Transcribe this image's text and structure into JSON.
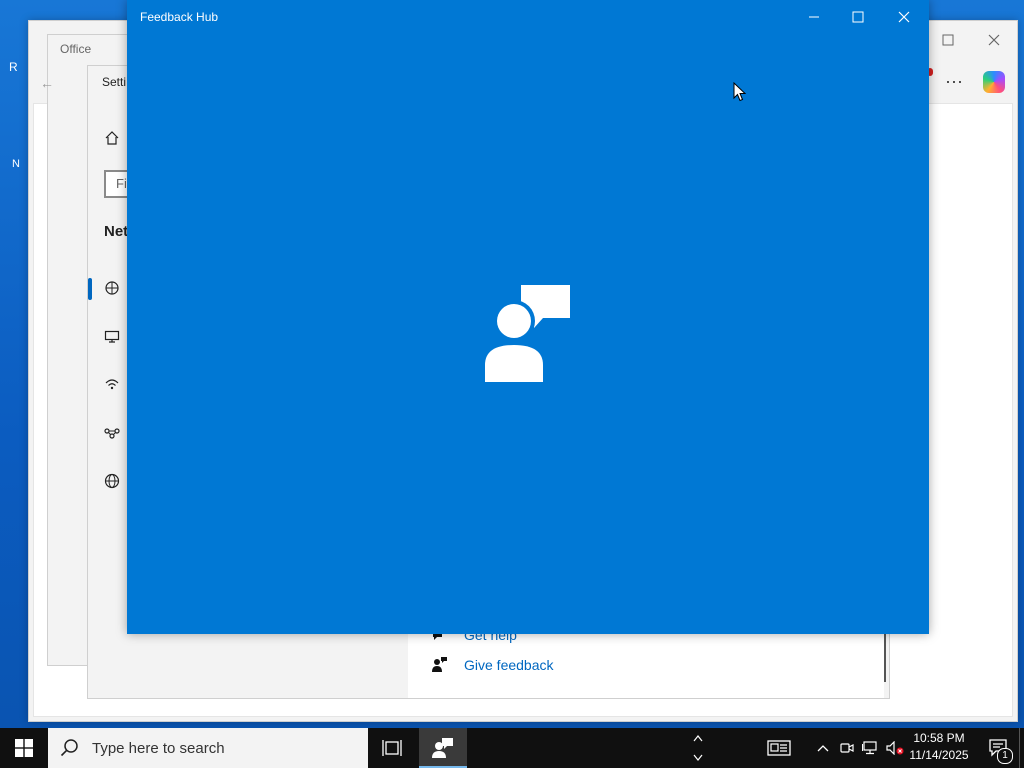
{
  "desktop": {
    "icon_labels": [
      "R",
      "N"
    ]
  },
  "edge_window": {
    "toolbar_more": "···"
  },
  "office_window": {
    "title": "Office"
  },
  "settings_window": {
    "title": "Setti",
    "find_placeholder": "Fi",
    "section_title": "Net",
    "links": {
      "get_help": "Get help",
      "give_feedback": "Give feedback"
    }
  },
  "feedback_window": {
    "title": "Feedback Hub"
  },
  "taskbar": {
    "search_placeholder": "Type here to search",
    "clock_time": "10:58 PM",
    "clock_date": "11/14/2025",
    "notification_count": "1"
  },
  "colors": {
    "feedback_blue": "#0078d4",
    "accent": "#0067c0",
    "taskbar": "#101010"
  }
}
